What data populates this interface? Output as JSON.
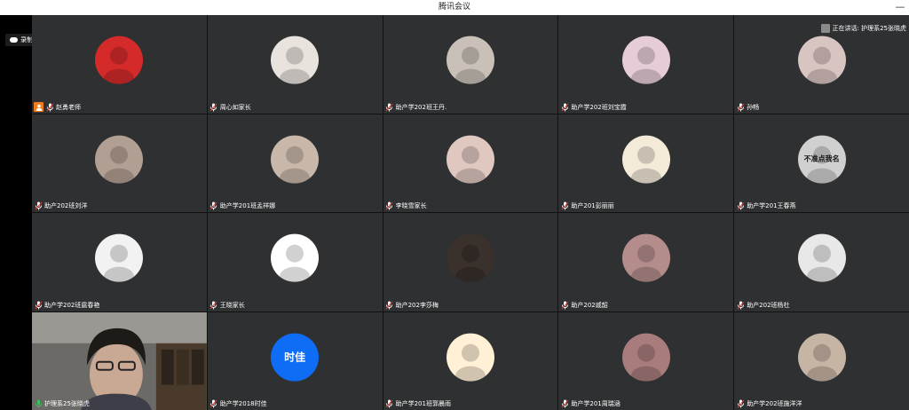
{
  "window": {
    "title": "腾讯会议"
  },
  "recording": {
    "label": "录制中"
  },
  "speaking": {
    "label": "正在讲话: 护理系25张晓虎"
  },
  "participants": [
    {
      "name": "赵勇老师",
      "avatar": "red-penguins",
      "bg": "#d42a2a",
      "host": true
    },
    {
      "name": "周心如家长",
      "avatar": "girl-hat",
      "bg": "#e9e3dd"
    },
    {
      "name": "助产学202班王丹.",
      "avatar": "girl-plaid",
      "bg": "#c9c1b8"
    },
    {
      "name": "助产学202班刘宝霞",
      "avatar": "girl-pink",
      "bg": "#e6ccd8"
    },
    {
      "name": "孙畅",
      "avatar": "hand",
      "bg": "#d8c4c0"
    },
    {
      "name": "助产202班刘洋",
      "avatar": "girl-smile",
      "bg": "#b29f93"
    },
    {
      "name": "助产学201班孟祥娜",
      "avatar": "fluffy-dog",
      "bg": "#c9b8aa"
    },
    {
      "name": "李晓雪家长",
      "avatar": "child",
      "bg": "#e0c7c0"
    },
    {
      "name": "助产201彭丽丽",
      "avatar": "duck-cartoon",
      "bg": "#f3ead8"
    },
    {
      "name": "助产学201王春燕",
      "avatar": "husky",
      "bg": "#d0d0d0",
      "overlay_text": "不准点我名"
    },
    {
      "name": "助产学202班扈春艳",
      "avatar": "anime-girl",
      "bg": "#f2f2f2"
    },
    {
      "name": "王晓家长",
      "avatar": "cartoon-boy",
      "bg": "#ffffff"
    },
    {
      "name": "助产202李莎梅",
      "avatar": "dark-portrait",
      "bg": "#3a302c"
    },
    {
      "name": "助产202戚韶",
      "avatar": "blur-pink",
      "bg": "#b48c8c"
    },
    {
      "name": "助产202班杨杜",
      "avatar": "sketch",
      "bg": "#e8e8e8"
    },
    {
      "name": "护理系25张晓虎",
      "camera": true,
      "active": true,
      "bg": "#5a5a58",
      "mic_active": true
    },
    {
      "name": "助产学2018时佳",
      "avatar_text": "时佳",
      "bg": "#0f6cf5"
    },
    {
      "name": "助产学201班郭晨雨",
      "avatar": "anime-boy",
      "bg": "#fff0d6"
    },
    {
      "name": "助产学201周瑞涵",
      "avatar": "girl-glasses",
      "bg": "#a87c7c"
    },
    {
      "name": "助产学202班施洋洋",
      "avatar": "anime-girl-glasses",
      "bg": "#c6b4a4"
    }
  ]
}
